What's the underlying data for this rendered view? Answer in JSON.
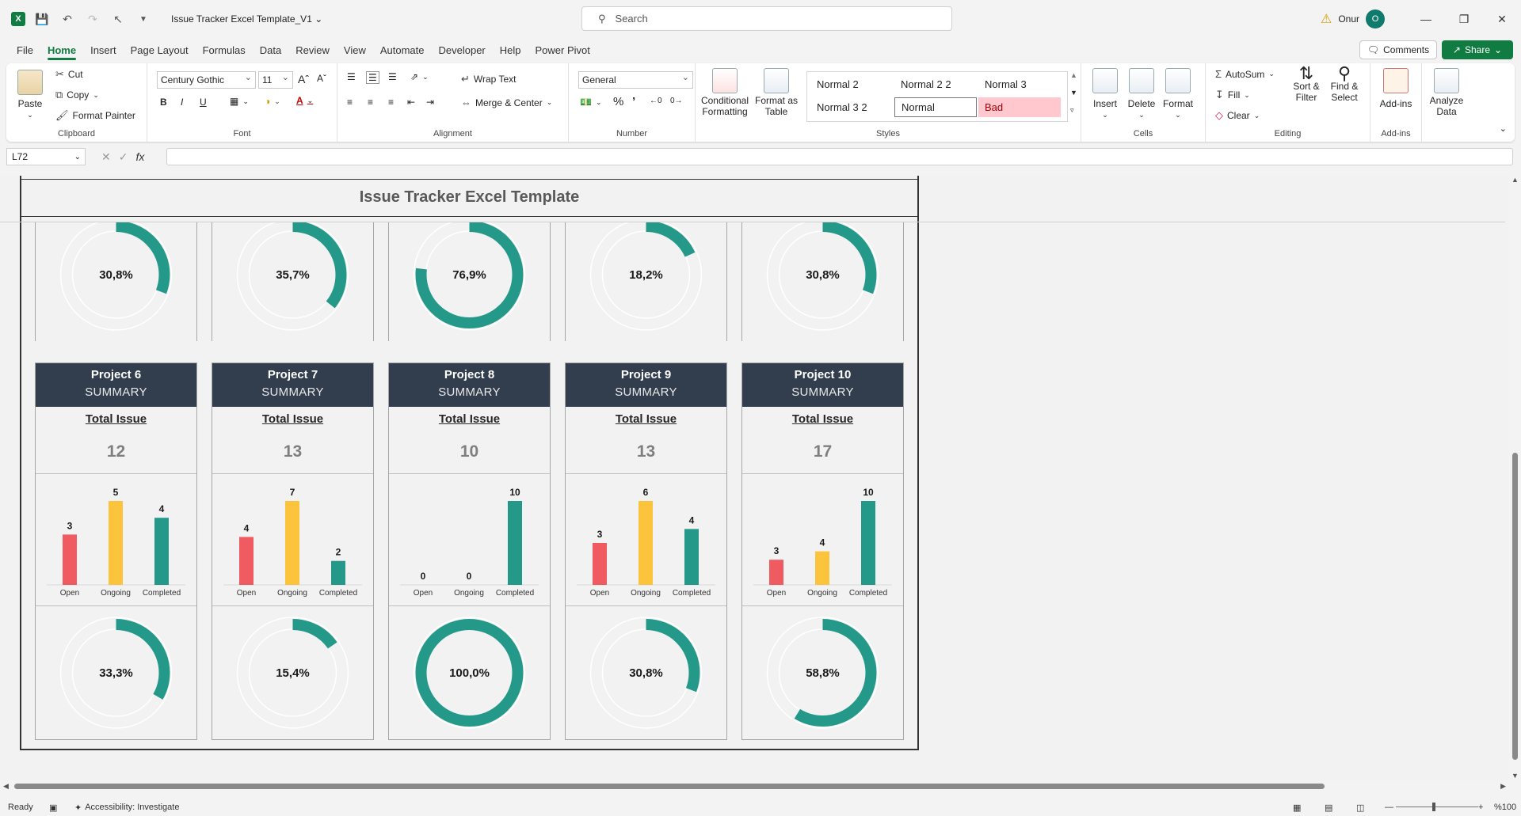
{
  "titlebar": {
    "doc_title": "Issue Tracker Excel Template_V1",
    "search_placeholder": "Search",
    "user_name": "Onur",
    "user_initial": "O"
  },
  "menu": {
    "tabs": [
      {
        "label": "File"
      },
      {
        "label": "Home"
      },
      {
        "label": "Insert"
      },
      {
        "label": "Page Layout"
      },
      {
        "label": "Formulas"
      },
      {
        "label": "Data"
      },
      {
        "label": "Review"
      },
      {
        "label": "View"
      },
      {
        "label": "Automate"
      },
      {
        "label": "Developer"
      },
      {
        "label": "Help"
      },
      {
        "label": "Power Pivot"
      }
    ],
    "active": "Home",
    "comments": "Comments",
    "share": "Share"
  },
  "ribbon": {
    "clipboard": {
      "label": "Clipboard",
      "paste": "Paste",
      "cut": "Cut",
      "copy": "Copy",
      "format_painter": "Format Painter"
    },
    "font": {
      "label": "Font",
      "family": "Century Gothic",
      "size": "11",
      "bold": "B",
      "italic": "I",
      "underline": "U"
    },
    "alignment": {
      "label": "Alignment",
      "wrap_text": "Wrap Text",
      "merge_center": "Merge & Center"
    },
    "number": {
      "label": "Number",
      "format": "General"
    },
    "styles": {
      "label": "Styles",
      "conditional_formatting": "Conditional Formatting",
      "format_as_table": "Format as Table",
      "cells": [
        "Normal 2",
        "Normal 2 2",
        "Normal 3",
        "Normal 3 2",
        "Normal",
        "Bad"
      ]
    },
    "cells": {
      "label": "Cells",
      "insert": "Insert",
      "delete": "Delete",
      "format": "Format"
    },
    "editing": {
      "label": "Editing",
      "autosum": "AutoSum",
      "fill": "Fill",
      "clear": "Clear",
      "sort_filter": "Sort & Filter",
      "find_select": "Find & Select"
    },
    "addins": {
      "label": "Add-ins",
      "addins": "Add-ins",
      "analyze": "Analyze Data"
    }
  },
  "formula_bar": {
    "name_box": "L72",
    "fx": "fx"
  },
  "dashboard": {
    "title": "Issue Tracker Excel Template",
    "top_row": [
      {
        "percent": "30,8%",
        "fraction": 0.308
      },
      {
        "percent": "35,7%",
        "fraction": 0.357
      },
      {
        "percent": "76,9%",
        "fraction": 0.769
      },
      {
        "percent": "18,2%",
        "fraction": 0.182
      },
      {
        "percent": "30,8%",
        "fraction": 0.308
      }
    ],
    "total_issue_label": "Total Issue",
    "summary_label": "SUMMARY",
    "projects": [
      {
        "name": "Project 6",
        "total": "12",
        "open": 3,
        "ongoing": 5,
        "completed": 4,
        "percent": "33,3%",
        "fraction": 0.333
      },
      {
        "name": "Project 7",
        "total": "13",
        "open": 4,
        "ongoing": 7,
        "completed": 2,
        "percent": "15,4%",
        "fraction": 0.154
      },
      {
        "name": "Project 8",
        "total": "10",
        "open": 0,
        "ongoing": 0,
        "completed": 10,
        "percent": "100,0%",
        "fraction": 1.0
      },
      {
        "name": "Project 9",
        "total": "13",
        "open": 3,
        "ongoing": 6,
        "completed": 4,
        "percent": "30,8%",
        "fraction": 0.308
      },
      {
        "name": "Project 10",
        "total": "17",
        "open": 3,
        "ongoing": 4,
        "completed": 10,
        "percent": "58,8%",
        "fraction": 0.588
      }
    ],
    "categories": [
      "Open",
      "Ongoing",
      "Completed"
    ],
    "colors": {
      "open": "#f05a61",
      "ongoing": "#fbc43c",
      "completed": "#24998a",
      "ring_bg": "#ffffff",
      "header": "#323d4e"
    }
  },
  "status": {
    "ready": "Ready",
    "accessibility": "Accessibility: Investigate",
    "zoom": "%100"
  }
}
